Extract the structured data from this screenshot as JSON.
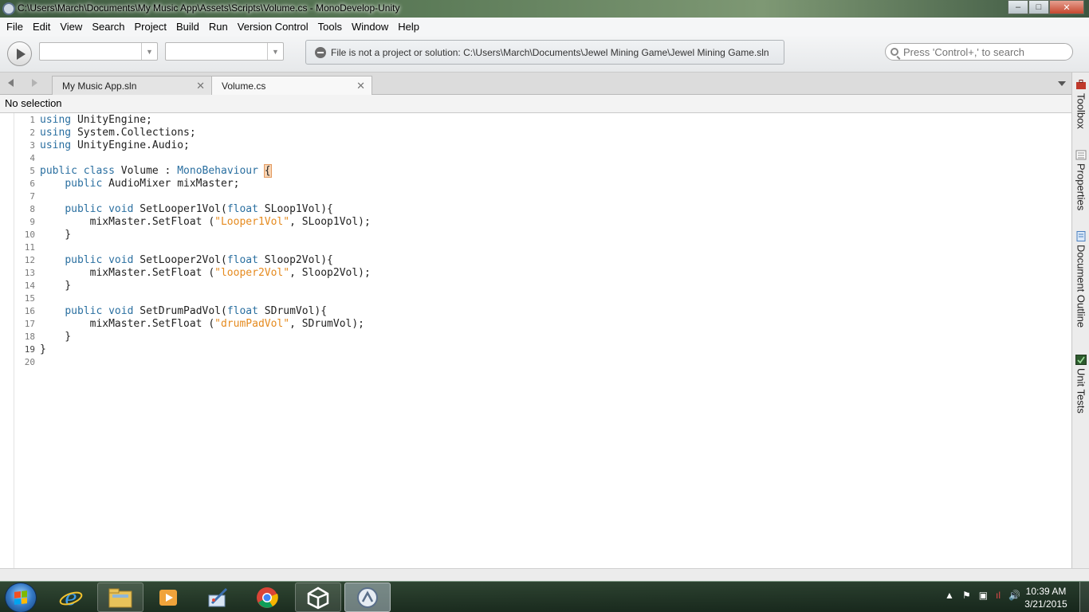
{
  "window": {
    "title": "C:\\Users\\March\\Documents\\My Music App\\Assets\\Scripts\\Volume.cs - MonoDevelop-Unity",
    "buttons": {
      "minimize": "–",
      "maximize": "□",
      "close": "✕"
    }
  },
  "menu": [
    "File",
    "Edit",
    "View",
    "Search",
    "Project",
    "Build",
    "Run",
    "Version Control",
    "Tools",
    "Window",
    "Help"
  ],
  "toolbar": {
    "config_value": "",
    "target_value": "",
    "status_message": "File is not a project or solution: C:\\Users\\March\\Documents\\Jewel Mining Game\\Jewel Mining Game.sln",
    "search_placeholder": "Press 'Control+,' to search"
  },
  "tabs": [
    {
      "label": "My Music App.sln",
      "active": false
    },
    {
      "label": "Volume.cs",
      "active": true
    }
  ],
  "path_bar": {
    "text": "No selection"
  },
  "editor": {
    "current_line": 19,
    "lines": [
      [
        [
          "kw",
          "using"
        ],
        [
          "plain",
          " UnityEngine;"
        ]
      ],
      [
        [
          "kw",
          "using"
        ],
        [
          "plain",
          " System.Collections;"
        ]
      ],
      [
        [
          "kw",
          "using"
        ],
        [
          "plain",
          " UnityEngine.Audio;"
        ]
      ],
      [],
      [
        [
          "kw",
          "public"
        ],
        [
          "plain",
          " "
        ],
        [
          "kw",
          "class"
        ],
        [
          "plain",
          " Volume : "
        ],
        [
          "ty",
          "MonoBehaviour"
        ],
        [
          "plain",
          " "
        ],
        [
          "brace-hl",
          "{"
        ]
      ],
      [
        [
          "plain",
          "    "
        ],
        [
          "kw",
          "public"
        ],
        [
          "plain",
          " AudioMixer mixMaster;"
        ]
      ],
      [],
      [
        [
          "plain",
          "    "
        ],
        [
          "kw",
          "public"
        ],
        [
          "plain",
          " "
        ],
        [
          "kw",
          "void"
        ],
        [
          "plain",
          " SetLooper1Vol("
        ],
        [
          "kw",
          "float"
        ],
        [
          "plain",
          " SLoop1Vol){"
        ]
      ],
      [
        [
          "plain",
          "        mixMaster.SetFloat ("
        ],
        [
          "str",
          "\"Looper1Vol\""
        ],
        [
          "plain",
          ", SLoop1Vol);"
        ]
      ],
      [
        [
          "plain",
          "    }"
        ]
      ],
      [],
      [
        [
          "plain",
          "    "
        ],
        [
          "kw",
          "public"
        ],
        [
          "plain",
          " "
        ],
        [
          "kw",
          "void"
        ],
        [
          "plain",
          " SetLooper2Vol("
        ],
        [
          "kw",
          "float"
        ],
        [
          "plain",
          " Sloop2Vol){"
        ]
      ],
      [
        [
          "plain",
          "        mixMaster.SetFloat ("
        ],
        [
          "str",
          "\"looper2Vol\""
        ],
        [
          "plain",
          ", Sloop2Vol);"
        ]
      ],
      [
        [
          "plain",
          "    }"
        ]
      ],
      [],
      [
        [
          "plain",
          "    "
        ],
        [
          "kw",
          "public"
        ],
        [
          "plain",
          " "
        ],
        [
          "kw",
          "void"
        ],
        [
          "plain",
          " SetDrumPadVol("
        ],
        [
          "kw",
          "float"
        ],
        [
          "plain",
          " SDrumVol){"
        ]
      ],
      [
        [
          "plain",
          "        mixMaster.SetFloat ("
        ],
        [
          "str",
          "\"drumPadVol\""
        ],
        [
          "plain",
          ", SDrumVol);"
        ]
      ],
      [
        [
          "plain",
          "    }"
        ]
      ],
      [
        [
          "plain",
          "}"
        ]
      ],
      []
    ]
  },
  "right_dock": [
    "Toolbox",
    "Properties",
    "Document Outline",
    "Unit Tests"
  ],
  "taskbar": {
    "apps": [
      {
        "name": "internet-explorer",
        "state": "pinned"
      },
      {
        "name": "file-explorer",
        "state": "pinned"
      },
      {
        "name": "media-player",
        "state": "pinned"
      },
      {
        "name": "paint",
        "state": "pinned"
      },
      {
        "name": "chrome",
        "state": "pinned"
      },
      {
        "name": "unity",
        "state": "pinned"
      },
      {
        "name": "monodevelop",
        "state": "active"
      }
    ],
    "clock_time": "10:39 AM",
    "clock_date": "3/21/2015"
  },
  "colors": {
    "keyword": "#2a6fa0",
    "string": "#e58a1e",
    "brace_highlight": "#f8d5b5"
  }
}
